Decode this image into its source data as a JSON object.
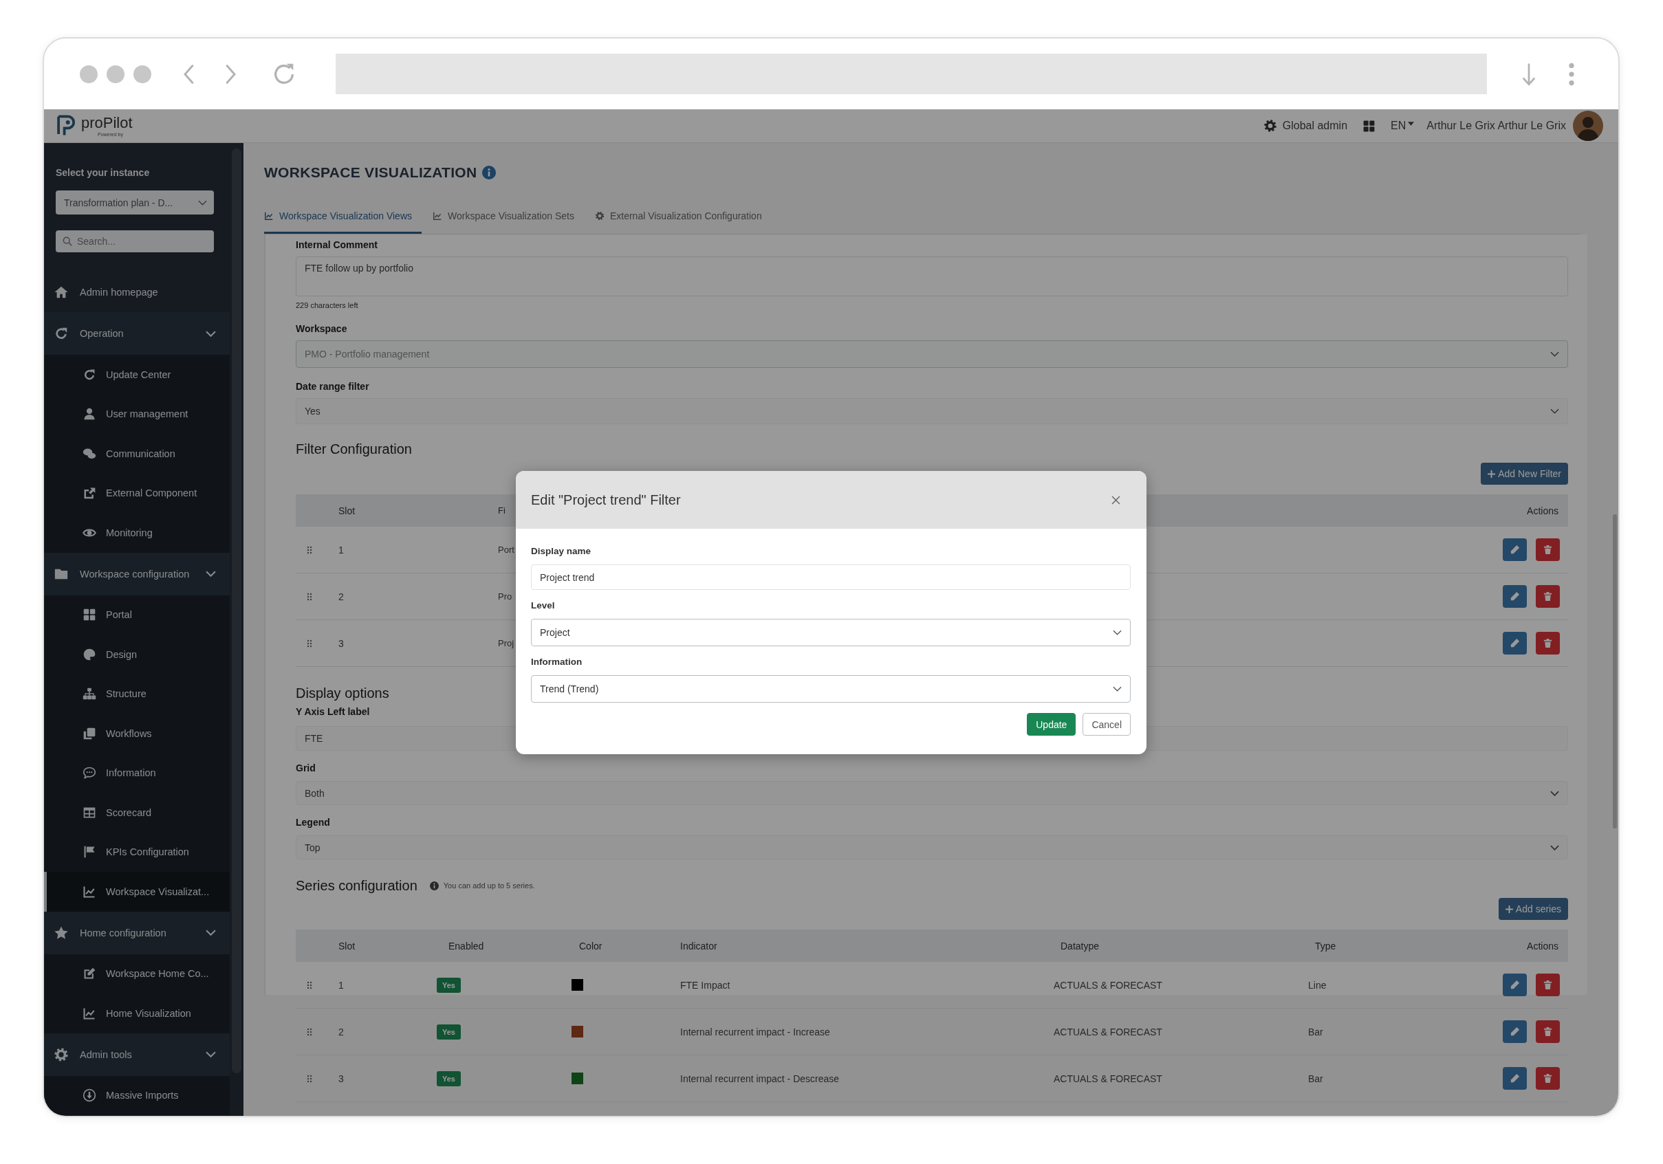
{
  "app_header": {
    "logo": "proPilot",
    "tagline": "Powered by",
    "role": "Global admin",
    "language": "EN",
    "user": "Arthur Le Grix Arthur Le Grix"
  },
  "sidebar": {
    "instance_label": "Select your instance",
    "instance_value": "Transformation plan - D...",
    "search_placeholder": "Search...",
    "items": [
      {
        "label": "Admin homepage",
        "selected": false
      },
      {
        "label": "Operation",
        "selected": false,
        "expanded": true,
        "children": [
          {
            "label": "Update Center",
            "selected": false
          },
          {
            "label": "User management",
            "selected": false
          },
          {
            "label": "Communication",
            "selected": false
          },
          {
            "label": "External Component",
            "selected": false
          },
          {
            "label": "Monitoring",
            "selected": false
          }
        ]
      },
      {
        "label": "Workspace configuration",
        "selected": false,
        "expanded": true,
        "children": [
          {
            "label": "Portal",
            "selected": false
          },
          {
            "label": "Design",
            "selected": false
          },
          {
            "label": "Structure",
            "selected": false
          },
          {
            "label": "Workflows",
            "selected": false
          },
          {
            "label": "Information",
            "selected": false
          },
          {
            "label": "Scorecard",
            "selected": false
          },
          {
            "label": "KPIs Configuration",
            "selected": false
          },
          {
            "label": "Workspace Visualizat...",
            "selected": true
          }
        ]
      },
      {
        "label": "Home configuration",
        "selected": false,
        "expanded": true,
        "children": [
          {
            "label": "Workspace Home Co...",
            "selected": false
          },
          {
            "label": "Home Visualization",
            "selected": false
          }
        ]
      },
      {
        "label": "Admin tools",
        "selected": false,
        "expanded": true,
        "children": [
          {
            "label": "Massive Imports",
            "selected": false
          }
        ]
      }
    ]
  },
  "page": {
    "title": "WORKSPACE VISUALIZATION",
    "tabs": [
      {
        "label": "Workspace Visualization Views",
        "selected": true
      },
      {
        "label": "Workspace Visualization Sets",
        "selected": false
      },
      {
        "label": "External Visualization Configuration",
        "selected": false
      }
    ]
  },
  "form_top": [
    {
      "kind": "textarea",
      "label": "Internal Comment",
      "value": "FTE follow up by portfolio",
      "helper": "229 characters left"
    },
    {
      "kind": "select",
      "label": "Workspace",
      "value": "PMO - Portfolio management"
    },
    {
      "kind": "select",
      "label": "Date range filter",
      "value": "Yes"
    }
  ],
  "filter_config": {
    "title": "Filter Configuration",
    "add_button": "Add New Filter",
    "columns": [
      "Slot",
      "Fi",
      "Actions"
    ],
    "rows": [
      {
        "slot": "1",
        "name": "Port"
      },
      {
        "slot": "2",
        "name": "Pro"
      },
      {
        "slot": "3",
        "name": "Proj"
      }
    ]
  },
  "display_options": {
    "title": "Display options",
    "fields": [
      {
        "kind": "input",
        "label": "Y Axis Left label",
        "value": "FTE"
      },
      {
        "kind": "select",
        "label": "Grid",
        "value": "Both"
      },
      {
        "kind": "select",
        "label": "Legend",
        "value": "Top"
      }
    ]
  },
  "series_config": {
    "title": "Series configuration",
    "note": "You can add up to 5 series.",
    "add_button": "Add series",
    "columns": [
      "Slot",
      "Enabled",
      "Color",
      "Indicator",
      "Datatype",
      "Type",
      "Actions"
    ],
    "rows": [
      {
        "slot": "1",
        "enabled": "Yes",
        "color": "#000000",
        "indicator": "FTE Impact",
        "datatype": "ACTUALS & FORECAST",
        "type": "Line"
      },
      {
        "slot": "2",
        "enabled": "Yes",
        "color": "#5e2813",
        "indicator": "Internal recurrent impact - Increase",
        "datatype": "ACTUALS & FORECAST",
        "type": "Bar"
      },
      {
        "slot": "3",
        "enabled": "Yes",
        "color": "#0f4515",
        "indicator": "Internal recurrent impact - Descrease",
        "datatype": "ACTUALS & FORECAST",
        "type": "Bar"
      }
    ]
  },
  "modal": {
    "title": "Edit \"Project trend\" Filter",
    "fields": [
      {
        "kind": "input",
        "label": "Display name",
        "value": "Project trend"
      },
      {
        "kind": "select",
        "label": "Level",
        "value": "Project"
      },
      {
        "kind": "select",
        "label": "Information",
        "value": "Trend (Trend)"
      }
    ],
    "buttons": [
      {
        "label": "Update",
        "kind": "primary"
      },
      {
        "label": "Cancel",
        "kind": "secondary"
      }
    ]
  }
}
